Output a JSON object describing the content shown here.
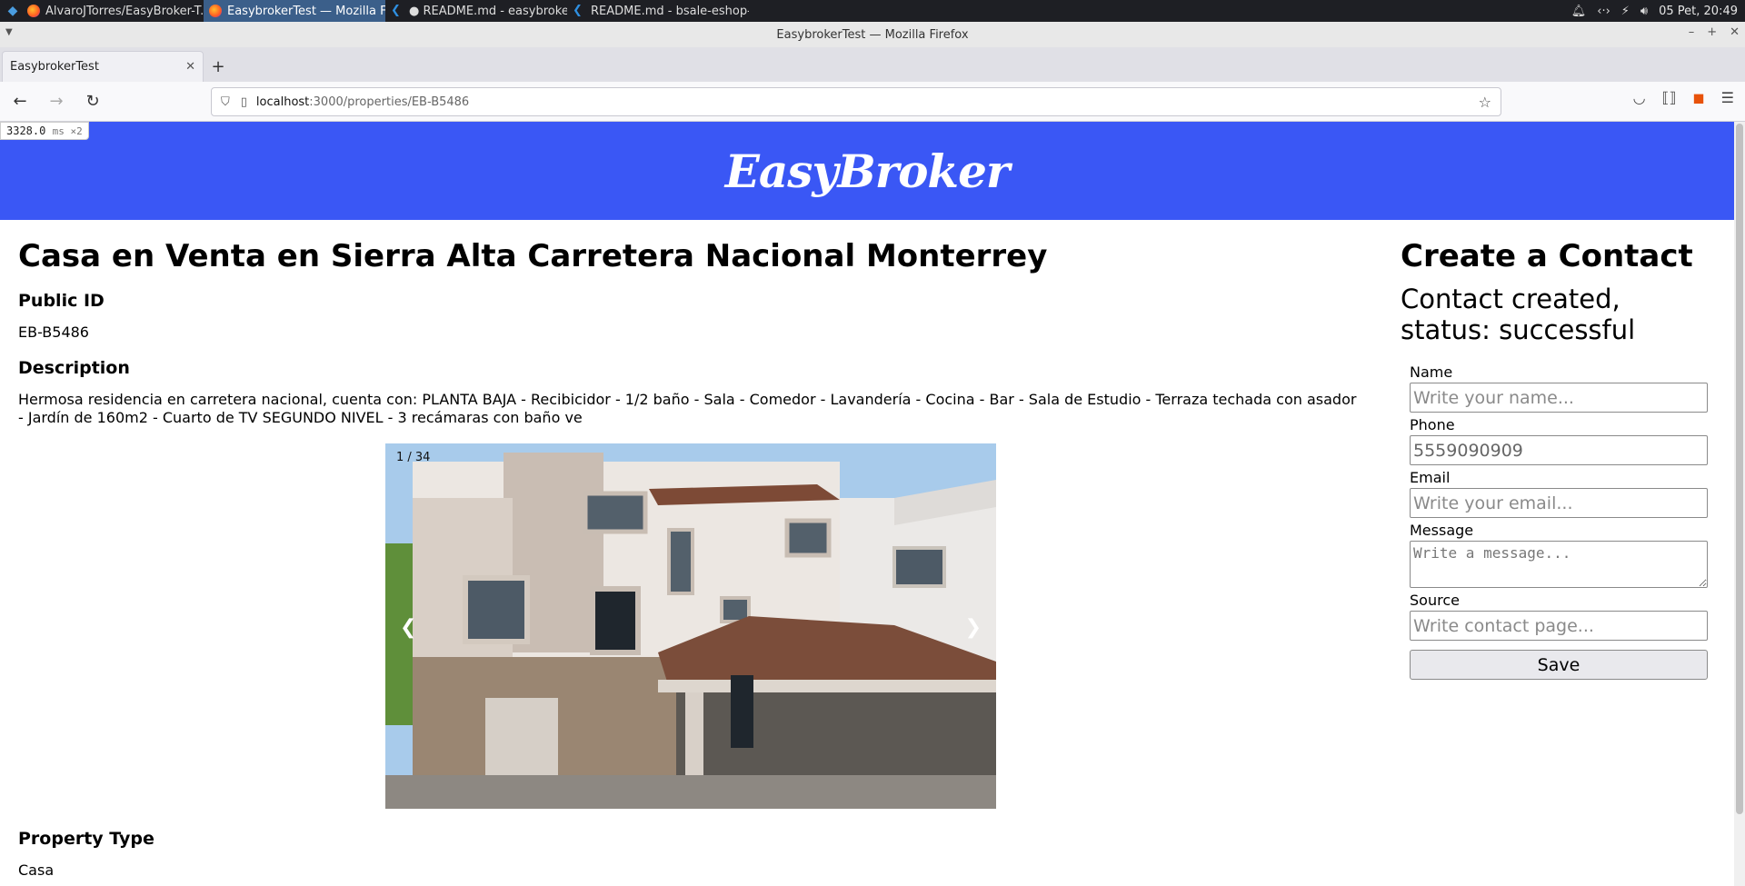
{
  "os": {
    "tasks": [
      {
        "label": "AlvaroJTorres/EasyBroker-T...",
        "icon": "firefox-icon",
        "active": false
      },
      {
        "label": "EasybrokerTest — Mozilla Fi...",
        "icon": "firefox-icon",
        "active": true
      },
      {
        "label": "● README.md - easybroker...",
        "icon": "vscode-icon",
        "active": false
      },
      {
        "label": "README.md - bsale-eshop-...",
        "icon": "vscode-icon",
        "active": false
      }
    ],
    "clock": "05 Pet, 20:49"
  },
  "browser": {
    "window_title": "EasybrokerTest — Mozilla Firefox",
    "tab_label": "EasybrokerTest",
    "url_host": "localhost",
    "url_path": ":3000/properties/EB-B5486",
    "timing_value": "3328.0",
    "timing_unit": "ms ×2"
  },
  "site": {
    "brand": "EasyBroker"
  },
  "property": {
    "title": "Casa en Venta en Sierra Alta Carretera Nacional Monterrey",
    "public_id_label": "Public ID",
    "public_id": "EB-B5486",
    "description_label": "Description",
    "description": "Hermosa residencia en carretera nacional, cuenta con: PLANTA BAJA - Recibicidor - 1/2 baño - Sala - Comedor - Lavandería - Cocina - Bar - Sala de Estudio - Terraza techada con asador - Jardín de 160m2 - Cuarto de TV SEGUNDO NIVEL - 3 recámaras con baño ve",
    "carousel_counter": "1 / 34",
    "carousel_prev": "❮",
    "carousel_next": "❯",
    "type_label": "Property Type",
    "type": "Casa"
  },
  "contact": {
    "title": "Create a Contact",
    "status": "Contact created, status: successful",
    "name_label": "Name",
    "name_placeholder": "Write your name...",
    "phone_label": "Phone",
    "phone_value": "5559090909",
    "email_label": "Email",
    "email_placeholder": "Write your email...",
    "message_label": "Message",
    "message_placeholder": "Write a message...",
    "source_label": "Source",
    "source_placeholder": "Write contact page...",
    "save_label": "Save"
  },
  "colors": {
    "brand_blue": "#3a57f5"
  }
}
